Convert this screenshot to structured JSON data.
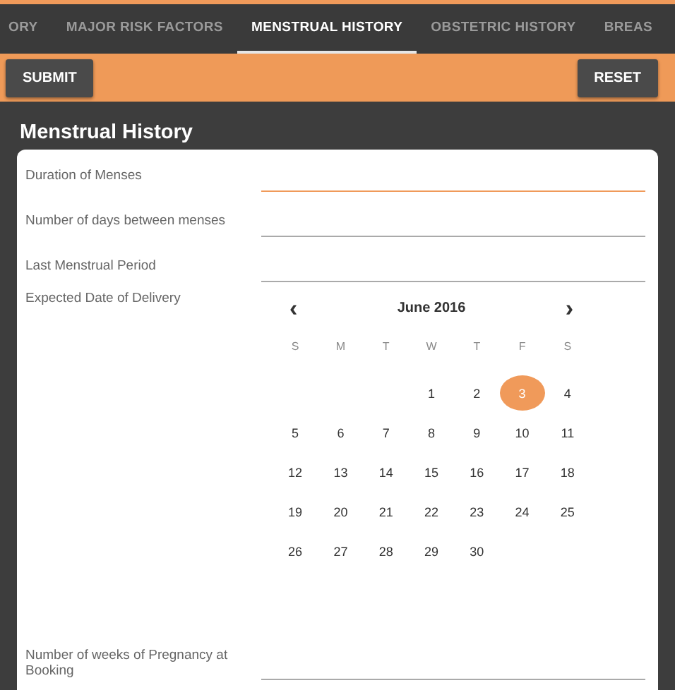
{
  "tabs": [
    {
      "label": "ORY",
      "selected": false
    },
    {
      "label": "MAJOR RISK FACTORS",
      "selected": false
    },
    {
      "label": "MENSTRUAL HISTORY",
      "selected": true
    },
    {
      "label": "OBSTETRIC HISTORY",
      "selected": false
    },
    {
      "label": "BREAS",
      "selected": false
    }
  ],
  "toolbar": {
    "submit": "SUBMIT",
    "reset": "RESET"
  },
  "section_title": "Menstrual History",
  "fields": [
    {
      "label": "Duration of Menses",
      "focused": true
    },
    {
      "label": "Number of days between menses",
      "focused": false
    },
    {
      "label": "Last Menstrual Period",
      "focused": false
    }
  ],
  "date_field": {
    "label": "Expected Date of Delivery",
    "calendar": {
      "prev": "‹",
      "next": "›",
      "month": "June 2016",
      "weekdays": [
        "S",
        "M",
        "T",
        "W",
        "T",
        "F",
        "S"
      ],
      "weeks": [
        [
          {
            "label": "1",
            "selected": false
          },
          {
            "label": "2",
            "selected": false
          },
          {
            "label": "3",
            "selected": true
          },
          {
            "label": "4",
            "selected": false
          }
        ],
        [
          {
            "label": "5",
            "selected": false
          },
          {
            "label": "6",
            "selected": false
          },
          {
            "label": "7",
            "selected": false
          },
          {
            "label": "8",
            "selected": false
          },
          {
            "label": "9",
            "selected": false
          },
          {
            "label": "10",
            "selected": false
          },
          {
            "label": "11",
            "selected": false
          }
        ],
        [
          {
            "label": "12",
            "selected": false
          },
          {
            "label": "13",
            "selected": false
          },
          {
            "label": "14",
            "selected": false
          },
          {
            "label": "15",
            "selected": false
          },
          {
            "label": "16",
            "selected": false
          },
          {
            "label": "17",
            "selected": false
          },
          {
            "label": "18",
            "selected": false
          }
        ],
        [
          {
            "label": "19",
            "selected": false
          },
          {
            "label": "20",
            "selected": false
          },
          {
            "label": "21",
            "selected": false
          },
          {
            "label": "22",
            "selected": false
          },
          {
            "label": "23",
            "selected": false
          },
          {
            "label": "24",
            "selected": false
          },
          {
            "label": "25",
            "selected": false
          }
        ],
        [
          {
            "label": "26",
            "selected": false
          },
          {
            "label": "27",
            "selected": false
          },
          {
            "label": "28",
            "selected": false
          },
          {
            "label": "29",
            "selected": false
          },
          {
            "label": "30",
            "selected": false
          }
        ]
      ]
    }
  },
  "bottom_field": {
    "label": "Number of weeks of Pregnancy at Booking",
    "focused": false
  }
}
